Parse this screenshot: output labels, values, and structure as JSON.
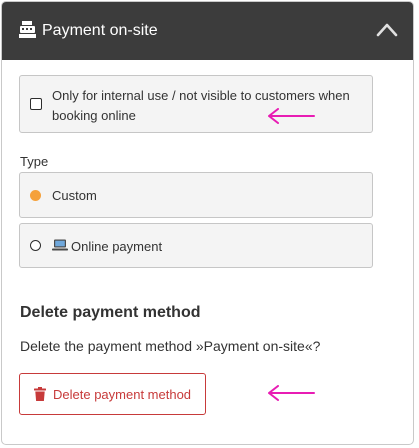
{
  "header": {
    "title": "Payment on-site",
    "icon": "cash-register-icon",
    "collapse_icon": "chevron-up-icon"
  },
  "internal_option": {
    "checked": false,
    "label": "Only for internal use / not visible to customers when booking online"
  },
  "type": {
    "label": "Type",
    "options": [
      {
        "label": "Custom",
        "selected": true
      },
      {
        "label": "Online payment",
        "selected": false,
        "icon": "laptop-icon"
      }
    ]
  },
  "delete_section": {
    "title": "Delete payment method",
    "text": "Delete the payment method »Payment on-site«?",
    "button_label": "Delete payment method",
    "button_icon": "trash-icon"
  },
  "colors": {
    "header_bg": "#3c3c3c",
    "accent": "#f5a13b",
    "danger": "#c73a3a",
    "annotation_arrow": "#e81cb4"
  }
}
